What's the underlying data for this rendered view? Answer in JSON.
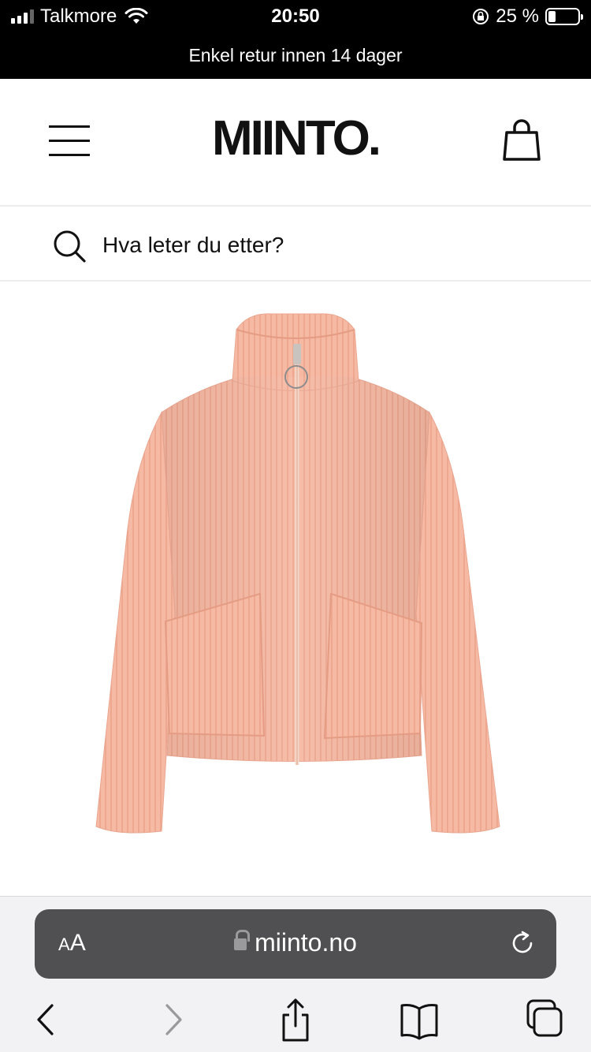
{
  "status_bar": {
    "carrier": "Talkmore",
    "time": "20:50",
    "battery_percent": "25 %",
    "battery_level": 0.25
  },
  "promo": {
    "text": "Enkel retur innen 14 dager"
  },
  "header": {
    "logo": "MIINTO."
  },
  "search": {
    "placeholder": "Hva leter du etter?"
  },
  "product": {
    "image_alt": "pink knitted zip cardigan",
    "color": "#f6b9a3"
  },
  "browser": {
    "text_size_label_small": "A",
    "text_size_label_large": "A",
    "url": "miinto.no"
  }
}
